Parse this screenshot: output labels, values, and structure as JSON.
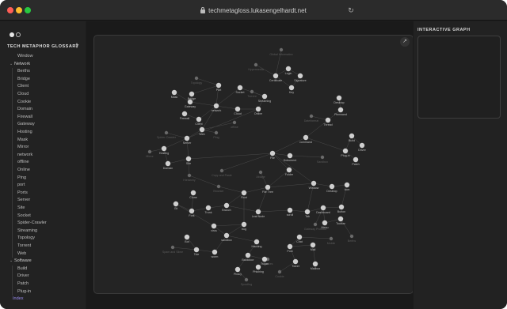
{
  "browser": {
    "url": "techmetagloss.lukasengelhardt.net"
  },
  "sidebar": {
    "title": "TECH METAPHOR GLOSSARY",
    "items": [
      {
        "label": "Window",
        "type": "leaf"
      },
      {
        "label": "Network",
        "type": "folder"
      },
      {
        "label": "Berths",
        "type": "leaf"
      },
      {
        "label": "Bridge",
        "type": "leaf"
      },
      {
        "label": "Client",
        "type": "leaf"
      },
      {
        "label": "Cloud",
        "type": "leaf"
      },
      {
        "label": "Cookie",
        "type": "leaf"
      },
      {
        "label": "Domain",
        "type": "leaf"
      },
      {
        "label": "Firewall",
        "type": "leaf"
      },
      {
        "label": "Gateway",
        "type": "leaf"
      },
      {
        "label": "Hosting",
        "type": "leaf"
      },
      {
        "label": "Mask",
        "type": "leaf"
      },
      {
        "label": "Mirror",
        "type": "leaf"
      },
      {
        "label": "network",
        "type": "leaf"
      },
      {
        "label": "offline",
        "type": "leaf"
      },
      {
        "label": "Online",
        "type": "leaf"
      },
      {
        "label": "Ping",
        "type": "leaf"
      },
      {
        "label": "port",
        "type": "leaf"
      },
      {
        "label": "Ports",
        "type": "leaf"
      },
      {
        "label": "Server",
        "type": "leaf"
      },
      {
        "label": "Site",
        "type": "leaf"
      },
      {
        "label": "Socket",
        "type": "leaf"
      },
      {
        "label": "Spider-Crawler",
        "type": "leaf"
      },
      {
        "label": "Streaming",
        "type": "leaf"
      },
      {
        "label": "Topology",
        "type": "leaf"
      },
      {
        "label": "Torrent",
        "type": "leaf"
      },
      {
        "label": "Web",
        "type": "leaf"
      },
      {
        "label": "Software",
        "type": "folder"
      },
      {
        "label": "Build",
        "type": "leaf"
      },
      {
        "label": "Driver",
        "type": "leaf"
      },
      {
        "label": "Patch",
        "type": "leaf"
      },
      {
        "label": "Plug-in",
        "type": "leaf"
      },
      {
        "label": "Index",
        "type": "active"
      }
    ]
  },
  "right_panel": {
    "title": "INTERACTIVE GRAPH"
  },
  "graph": {
    "nodes": [
      {
        "id": "n1",
        "label": "Global Information",
        "dim": true
      },
      {
        "id": "n2",
        "label": "Hypermedia",
        "dim": true
      },
      {
        "id": "n3",
        "label": "Certificate",
        "dim": false
      },
      {
        "id": "n4",
        "label": "Login",
        "dim": false
      },
      {
        "id": "n5",
        "label": "Signature",
        "dim": false
      },
      {
        "id": "n6",
        "label": "Key",
        "dim": false
      },
      {
        "id": "n7",
        "label": "Topology",
        "dim": true
      },
      {
        "id": "n8",
        "label": "Mask",
        "dim": false
      },
      {
        "id": "n9",
        "label": "Bridge",
        "dim": false
      },
      {
        "id": "n10",
        "label": "Port",
        "dim": false
      },
      {
        "id": "n11",
        "label": "Socket",
        "dim": false
      },
      {
        "id": "n12",
        "label": "Torrent",
        "dim": true
      },
      {
        "id": "n13",
        "label": "Streaming",
        "dim": false
      },
      {
        "id": "n14",
        "label": "Gateway",
        "dim": false
      },
      {
        "id": "n15",
        "label": "network",
        "dim": false
      },
      {
        "id": "n16",
        "label": "Cloud",
        "dim": false
      },
      {
        "id": "n17",
        "label": "Online",
        "dim": false
      },
      {
        "id": "n18",
        "label": "Firewall",
        "dim": false
      },
      {
        "id": "n19",
        "label": "Client",
        "dim": false
      },
      {
        "id": "n20",
        "label": "offline",
        "dim": true
      },
      {
        "id": "n21",
        "label": "Web",
        "dim": false
      },
      {
        "id": "n22",
        "label": "Ping",
        "dim": true
      },
      {
        "id": "n23",
        "label": "Spider-Crawler",
        "dim": true
      },
      {
        "id": "n24",
        "label": "Server",
        "dim": false
      },
      {
        "id": "n25",
        "label": "Mirror",
        "dim": true
      },
      {
        "id": "n26",
        "label": "Hosting",
        "dim": false
      },
      {
        "id": "n27",
        "label": "Site",
        "dim": false
      },
      {
        "id": "n28",
        "label": "Domain",
        "dim": false
      },
      {
        "id": "n29",
        "label": "Dateiformat",
        "dim": true
      },
      {
        "id": "n30",
        "label": "Desktop",
        "dim": false
      },
      {
        "id": "n31",
        "label": "Pinnwand",
        "dim": false
      },
      {
        "id": "n32",
        "label": "Thread",
        "dim": false
      },
      {
        "id": "n33",
        "label": "command",
        "dim": false
      },
      {
        "id": "n34",
        "label": "Build",
        "dim": false
      },
      {
        "id": "n35",
        "label": "Plug-in",
        "dim": false
      },
      {
        "id": "n36",
        "label": "Driver",
        "dim": false
      },
      {
        "id": "n37",
        "label": "Patch",
        "dim": false
      },
      {
        "id": "n38",
        "label": "File",
        "dim": false
      },
      {
        "id": "n39",
        "label": "Dokument",
        "dim": false
      },
      {
        "id": "n40",
        "label": "Folder",
        "dim": false
      },
      {
        "id": "n41",
        "label": "Sandbox",
        "dim": true
      },
      {
        "id": "n42",
        "label": "Copy and Paste",
        "dim": true
      },
      {
        "id": "n43",
        "label": "Ablage",
        "dim": true
      },
      {
        "id": "n44",
        "label": "Hierarchy",
        "dim": true
      },
      {
        "id": "n45",
        "label": "Browser",
        "dim": true
      },
      {
        "id": "n46",
        "label": "Root",
        "dim": false
      },
      {
        "id": "n47",
        "label": "File Tree",
        "dim": false
      },
      {
        "id": "n48",
        "label": "Window",
        "dim": false
      },
      {
        "id": "n49",
        "label": "Desktop",
        "dim": false
      },
      {
        "id": "n50",
        "label": "Icon",
        "dim": false
      },
      {
        "id": "n51",
        "label": "Clone",
        "dim": false
      },
      {
        "id": "n52",
        "label": "Git",
        "dim": false
      },
      {
        "id": "n53",
        "label": "Fork",
        "dim": false
      },
      {
        "id": "n54",
        "label": "Trunk",
        "dim": false
      },
      {
        "id": "n55",
        "label": "Branch",
        "dim": false
      },
      {
        "id": "n56",
        "label": "Leaf Node",
        "dim": false
      },
      {
        "id": "n57",
        "label": "scroll",
        "dim": false
      },
      {
        "id": "n58",
        "label": "Tab",
        "dim": false
      },
      {
        "id": "n59",
        "label": "Dashboard",
        "dim": false
      },
      {
        "id": "n60",
        "label": "Button",
        "dim": false
      },
      {
        "id": "n61",
        "label": "Menu",
        "dim": false
      },
      {
        "id": "n62",
        "label": "Toolbar",
        "dim": false
      },
      {
        "id": "n63",
        "label": "bug",
        "dim": false
      },
      {
        "id": "n64",
        "label": "virus",
        "dim": false
      },
      {
        "id": "n65",
        "label": "sandbox",
        "dim": false
      },
      {
        "id": "n66",
        "label": "Hacking",
        "dim": false
      },
      {
        "id": "n67",
        "label": "Bot",
        "dim": false
      },
      {
        "id": "n68",
        "label": "Spam and Slime",
        "dim": true
      },
      {
        "id": "n69",
        "label": "Tole",
        "dim": false
      },
      {
        "id": "n70",
        "label": "worm",
        "dim": false
      },
      {
        "id": "n71",
        "label": "Backdoor",
        "dim": false
      },
      {
        "id": "n72",
        "label": "Cookies",
        "dim": true
      },
      {
        "id": "n73",
        "label": "Trojan",
        "dim": false
      },
      {
        "id": "n74",
        "label": "Phishing",
        "dim": false
      },
      {
        "id": "n75",
        "label": "Piracy",
        "dim": false
      },
      {
        "id": "n76",
        "label": "Spoofing",
        "dim": true
      },
      {
        "id": "n77",
        "label": "Chat",
        "dim": false
      },
      {
        "id": "n78",
        "label": "Post",
        "dim": false
      },
      {
        "id": "n79",
        "label": "Mail",
        "dim": false
      },
      {
        "id": "n80",
        "label": "Tweet",
        "dim": false
      },
      {
        "id": "n81",
        "label": "Mailbox",
        "dim": false
      },
      {
        "id": "n82",
        "label": "Mobile",
        "dim": true
      },
      {
        "id": "n83",
        "label": "Berths",
        "dim": true
      },
      {
        "id": "n84",
        "label": "Gateway Protocol",
        "dim": true
      },
      {
        "id": "n85",
        "label": "Cookie",
        "dim": true
      }
    ]
  }
}
